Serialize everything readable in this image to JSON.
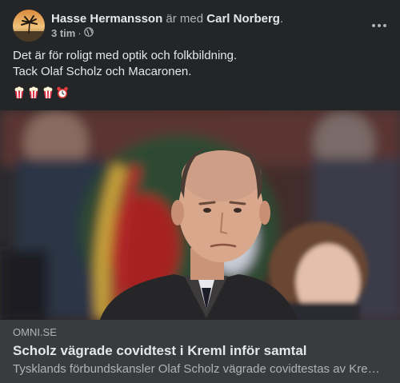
{
  "post": {
    "author": "Hasse Hermansson",
    "with_text": "är med",
    "tagged": "Carl Norberg",
    "tagged_suffix": ".",
    "time": "3 tim",
    "separator": "·",
    "audience_icon": "globe-icon",
    "menu_icon": "more-options-icon",
    "text_line1": "Det är för roligt med optik och folkbildning.",
    "text_line2": "Tack Olaf Scholz och Macaronen.",
    "emojis": [
      "popcorn-icon",
      "popcorn-icon",
      "popcorn-icon",
      "alarm-clock-icon"
    ]
  },
  "link": {
    "domain": "OMNI.SE",
    "headline": "Scholz vägrade covidtest i Kreml inför samtal",
    "description": "Tysklands förbundskansler Olaf Scholz vägrade covidtestas av Kremls läkare"
  },
  "colors": {
    "background": "#242526",
    "link_box": "#3a3b3c",
    "primary_text": "#e4e6eb",
    "secondary_text": "#b0b3b8"
  }
}
